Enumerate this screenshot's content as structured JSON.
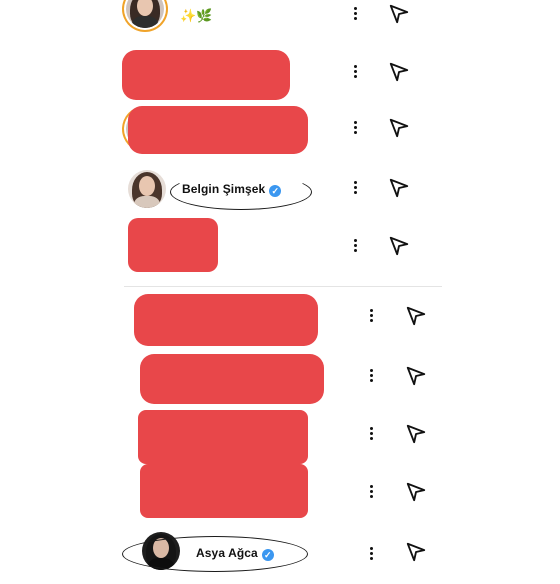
{
  "rows": [
    {
      "name": "✨🌿"
    },
    {
      "name": ""
    },
    {
      "name": ""
    },
    {
      "name": "Belgin Şimşek",
      "verified": "✓"
    },
    {
      "name": ""
    },
    {
      "name": ""
    },
    {
      "name": ""
    },
    {
      "name": ""
    },
    {
      "name": ""
    },
    {
      "name": "Asya Ağca",
      "verified": "✓"
    }
  ],
  "icons": {
    "more": "more-vertical-icon",
    "send": "send-icon",
    "verified": "verified-badge-icon"
  },
  "colors": {
    "redaction": "#e8474a",
    "verified": "#3b97f0",
    "story_ring": "#f0a32a"
  }
}
